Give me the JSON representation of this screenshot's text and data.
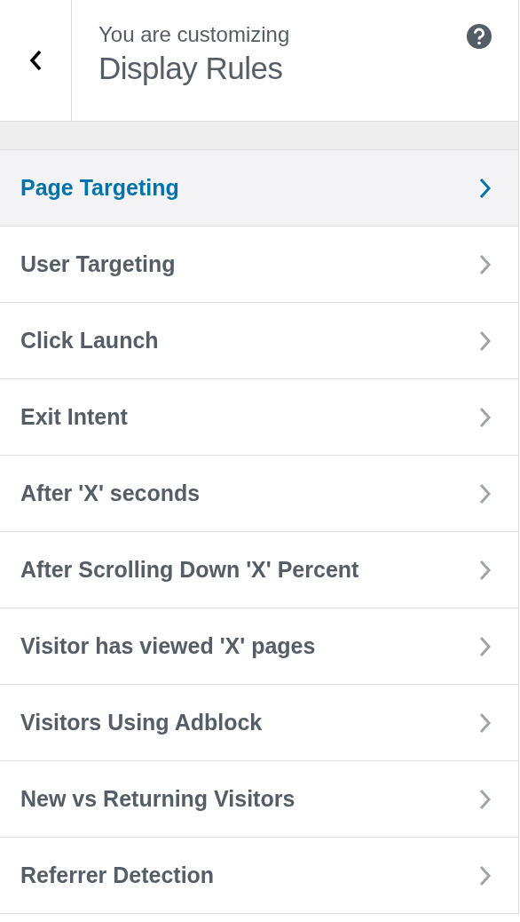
{
  "header": {
    "subtitle": "You are customizing",
    "title": "Display Rules"
  },
  "sections": [
    {
      "label": "Page Targeting",
      "selected": true
    },
    {
      "label": "User Targeting",
      "selected": false
    },
    {
      "label": "Click Launch",
      "selected": false
    },
    {
      "label": "Exit Intent",
      "selected": false
    },
    {
      "label": "After 'X' seconds",
      "selected": false
    },
    {
      "label": "After Scrolling Down 'X' Percent",
      "selected": false
    },
    {
      "label": "Visitor has viewed 'X' pages",
      "selected": false
    },
    {
      "label": "Visitors Using Adblock",
      "selected": false
    },
    {
      "label": "New vs Returning Visitors",
      "selected": false
    },
    {
      "label": "Referrer Detection",
      "selected": false
    }
  ]
}
